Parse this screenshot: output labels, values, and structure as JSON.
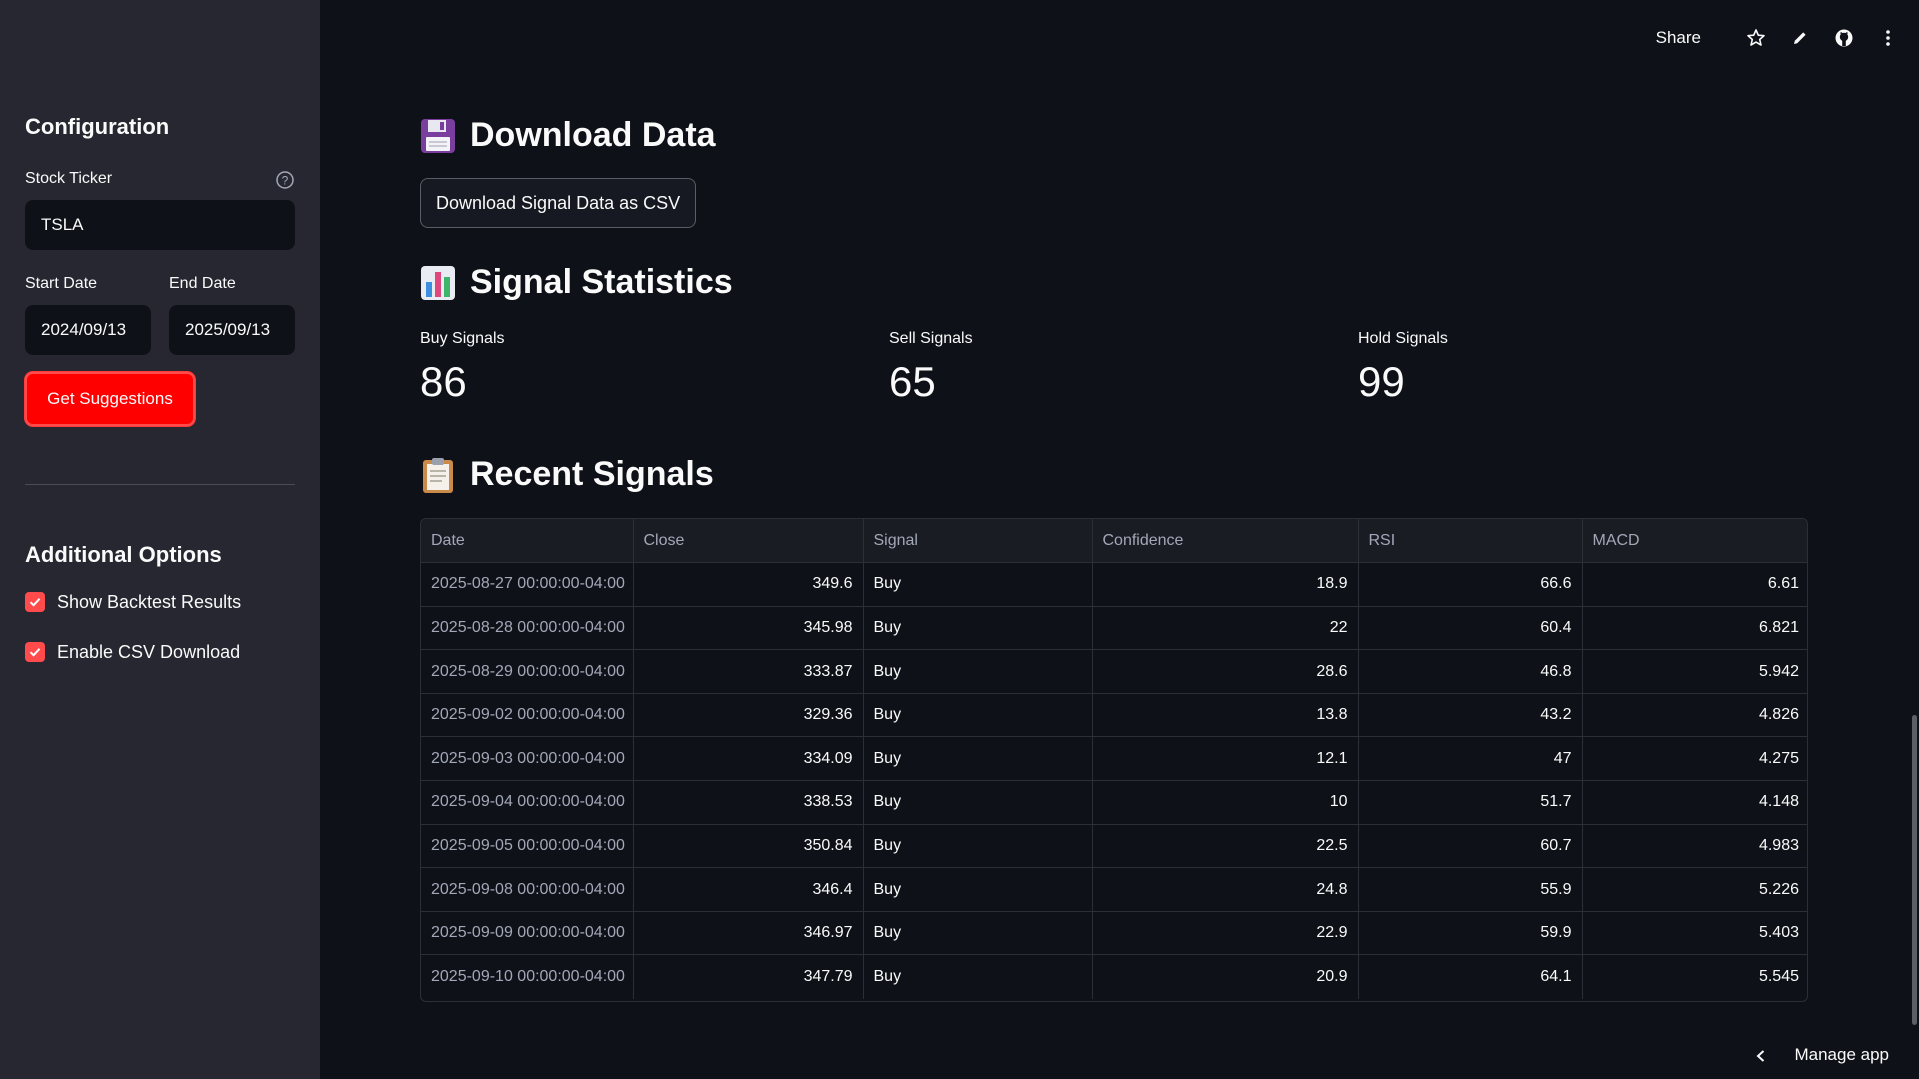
{
  "sidebar": {
    "title": "Configuration",
    "ticker_label": "Stock Ticker",
    "ticker_value": "TSLA",
    "start_label": "Start Date",
    "start_value": "2024/09/13",
    "end_label": "End Date",
    "end_value": "2025/09/13",
    "suggest_button": "Get Suggestions",
    "options_title": "Additional Options",
    "options": [
      {
        "label": "Show Backtest Results",
        "checked": true
      },
      {
        "label": "Enable CSV Download",
        "checked": true
      }
    ]
  },
  "toolbar": {
    "share": "Share",
    "icons": [
      "star-icon",
      "pencil-icon",
      "github-icon",
      "more-vertical-icon"
    ]
  },
  "download": {
    "heading": "Download Data",
    "icon": "floppy-disk-icon",
    "button": "Download Signal Data as CSV"
  },
  "stats": {
    "heading": "Signal Statistics",
    "icon": "bar-chart-icon",
    "metrics": [
      {
        "label": "Buy Signals",
        "value": "86"
      },
      {
        "label": "Sell Signals",
        "value": "65"
      },
      {
        "label": "Hold Signals",
        "value": "99"
      }
    ]
  },
  "recent": {
    "heading": "Recent Signals",
    "icon": "clipboard-icon",
    "columns": [
      "Date",
      "Close",
      "Signal",
      "Confidence",
      "RSI",
      "MACD"
    ],
    "rows": [
      [
        "2025-08-27 00:00:00-04:00",
        "349.6",
        "Buy",
        "18.9",
        "66.6",
        "6.61"
      ],
      [
        "2025-08-28 00:00:00-04:00",
        "345.98",
        "Buy",
        "22",
        "60.4",
        "6.821"
      ],
      [
        "2025-08-29 00:00:00-04:00",
        "333.87",
        "Buy",
        "28.6",
        "46.8",
        "5.942"
      ],
      [
        "2025-09-02 00:00:00-04:00",
        "329.36",
        "Buy",
        "13.8",
        "43.2",
        "4.826"
      ],
      [
        "2025-09-03 00:00:00-04:00",
        "334.09",
        "Buy",
        "12.1",
        "47",
        "4.275"
      ],
      [
        "2025-09-04 00:00:00-04:00",
        "338.53",
        "Buy",
        "10",
        "51.7",
        "4.148"
      ],
      [
        "2025-09-05 00:00:00-04:00",
        "350.84",
        "Buy",
        "22.5",
        "60.7",
        "4.983"
      ],
      [
        "2025-09-08 00:00:00-04:00",
        "346.4",
        "Buy",
        "24.8",
        "55.9",
        "5.226"
      ],
      [
        "2025-09-09 00:00:00-04:00",
        "346.97",
        "Buy",
        "22.9",
        "59.9",
        "5.403"
      ],
      [
        "2025-09-10 00:00:00-04:00",
        "347.79",
        "Buy",
        "20.9",
        "64.1",
        "5.545"
      ]
    ]
  },
  "footer": {
    "manage": "Manage app"
  },
  "colors": {
    "background": "#0e1117",
    "sidebar": "#262730",
    "accent": "#ff4b4b",
    "primary_button": "#ff0000"
  }
}
